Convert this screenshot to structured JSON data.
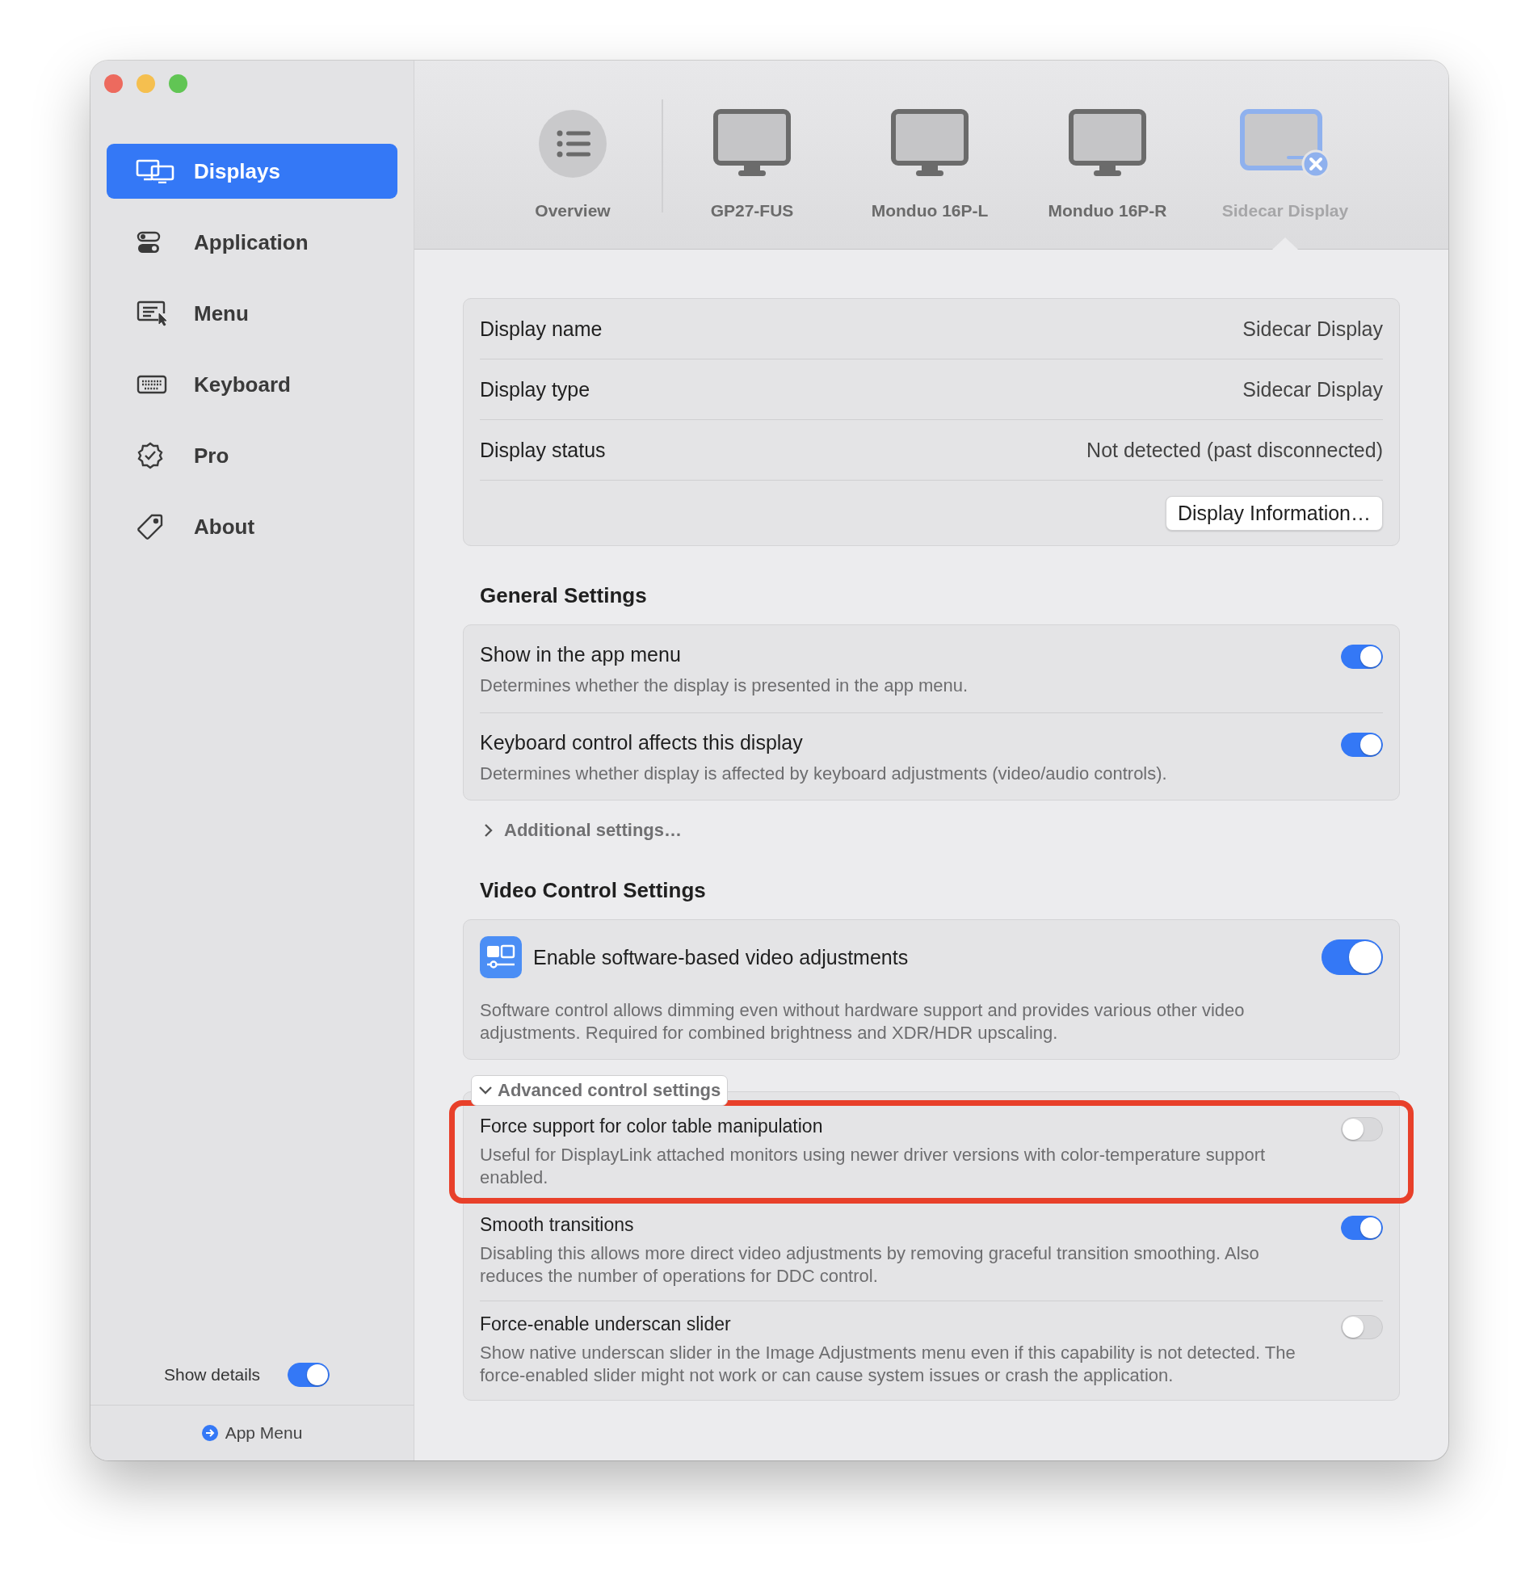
{
  "sidebar": {
    "items": [
      {
        "label": "Displays",
        "selected": true
      },
      {
        "label": "Application",
        "selected": false
      },
      {
        "label": "Menu",
        "selected": false
      },
      {
        "label": "Keyboard",
        "selected": false
      },
      {
        "label": "Pro",
        "selected": false
      },
      {
        "label": "About",
        "selected": false
      }
    ],
    "show_details": {
      "label": "Show details",
      "on": true
    },
    "footer_link": "App Menu"
  },
  "toolbar": {
    "items": [
      {
        "kind": "overview",
        "label": "Overview",
        "selected": false,
        "disconnected": false
      },
      {
        "kind": "monitor",
        "label": "GP27-FUS",
        "selected": false,
        "disconnected": false
      },
      {
        "kind": "monitor",
        "label": "Monduo 16P-L",
        "selected": false,
        "disconnected": false
      },
      {
        "kind": "monitor",
        "label": "Monduo 16P-R",
        "selected": false,
        "disconnected": false
      },
      {
        "kind": "sidecar",
        "label": "Sidecar Display",
        "selected": true,
        "disconnected": true
      }
    ]
  },
  "info": {
    "rows": [
      {
        "label": "Display name",
        "value": "Sidecar Display"
      },
      {
        "label": "Display type",
        "value": "Sidecar Display"
      },
      {
        "label": "Display status",
        "value": "Not detected (past disconnected)"
      }
    ],
    "button": "Display Information…"
  },
  "general": {
    "heading": "General Settings",
    "rows": [
      {
        "title": "Show in the app menu",
        "description": "Determines whether the display is presented in the app menu.",
        "on": true
      },
      {
        "title": "Keyboard control affects this display",
        "description": "Determines whether display is affected by keyboard adjustments (video/audio controls).",
        "on": true
      }
    ]
  },
  "additional": {
    "label": "Additional settings…",
    "expanded": false
  },
  "video": {
    "heading": "Video Control Settings",
    "main": {
      "title": "Enable software-based video adjustments",
      "description": "Software control allows dimming even without hardware support and provides various other video adjustments. Required for combined brightness and XDR/HDR upscaling.",
      "on": true
    },
    "advanced": {
      "label": "Advanced control settings",
      "expanded": true,
      "rows": [
        {
          "title": "Force support for color table manipulation",
          "description": "Useful for DisplayLink attached monitors using newer driver versions with color-temperature support enabled.",
          "on": false,
          "highlighted": true
        },
        {
          "title": "Smooth transitions",
          "description": "Disabling this allows more direct video adjustments by removing graceful transition smoothing. Also reduces the number of operations for DDC control.",
          "on": true,
          "highlighted": false
        },
        {
          "title": "Force-enable underscan slider",
          "description": "Show native underscan slider in the Image Adjustments menu even if this capability is not detected. The force-enabled slider might not work or can cause system issues or crash the application.",
          "on": false,
          "highlighted": false
        }
      ]
    }
  }
}
